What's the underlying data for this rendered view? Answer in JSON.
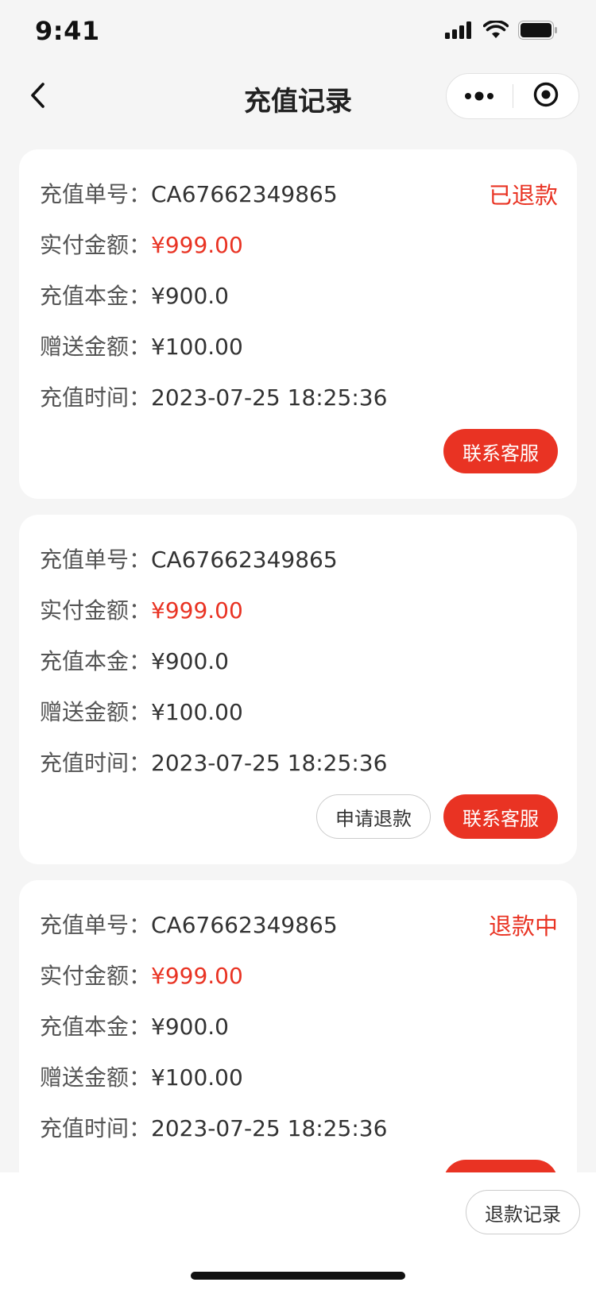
{
  "status_bar": {
    "time": "9:41"
  },
  "nav": {
    "title": "充值记录"
  },
  "labels": {
    "order_no": "充值单号：",
    "paid": "实付金额：",
    "principal": "充值本金：",
    "bonus": "赠送金额：",
    "time": "充值时间："
  },
  "records": [
    {
      "order_no": "CA67662349865",
      "paid": "¥999.00",
      "principal": "¥900.0",
      "bonus": "¥100.00",
      "time": "2023-07-25 18:25:36",
      "status": "已退款",
      "contact_label": "联系客服"
    },
    {
      "order_no": "CA67662349865",
      "paid": "¥999.00",
      "principal": "¥900.0",
      "bonus": "¥100.00",
      "time": "2023-07-25 18:25:36",
      "refund_label": "申请退款",
      "contact_label": "联系客服"
    },
    {
      "order_no": "CA67662349865",
      "paid": "¥999.00",
      "principal": "¥900.0",
      "bonus": "¥100.00",
      "time": "2023-07-25 18:25:36",
      "status": "退款中"
    }
  ],
  "bottom": {
    "refund_record_label": "退款记录"
  },
  "colors": {
    "accent": "#e93323",
    "background": "#f5f5f5",
    "card": "#ffffff"
  }
}
